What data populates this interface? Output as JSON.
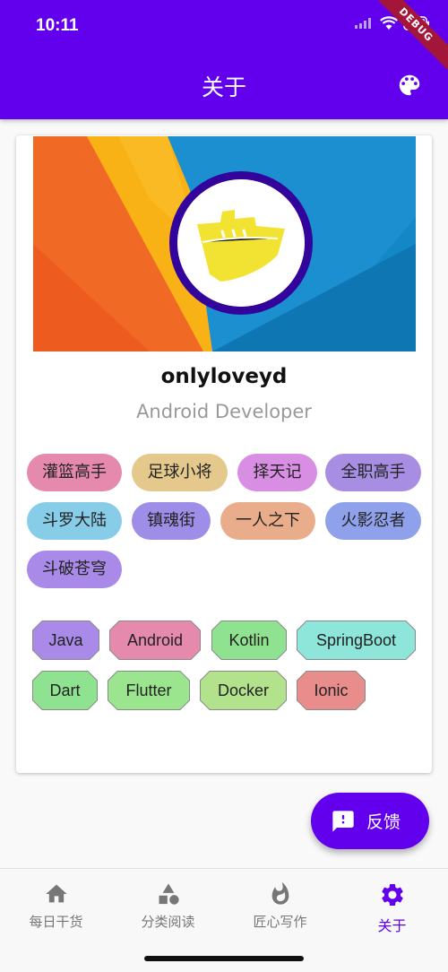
{
  "status_bar": {
    "time": "10:11",
    "debug_label": "DEBUG"
  },
  "appbar": {
    "title": "关于",
    "palette_icon": "palette-icon",
    "color": "#6200ee"
  },
  "profile": {
    "name": "onlyloveyd",
    "role": "Android Developer",
    "avatar_icon": "ship-icon"
  },
  "interests": [
    {
      "label": "灌篮高手",
      "color": "#e589ad"
    },
    {
      "label": "足球小将",
      "color": "#e5c98c"
    },
    {
      "label": "择天记",
      "color": "#d88ee3"
    },
    {
      "label": "全职高手",
      "color": "#a88ee3"
    },
    {
      "label": "斗罗大陆",
      "color": "#88cde8"
    },
    {
      "label": "镇魂街",
      "color": "#9e8ee7"
    },
    {
      "label": "一人之下",
      "color": "#e9ad8b"
    },
    {
      "label": "火影忍者",
      "color": "#8fa1eb"
    },
    {
      "label": "斗破苍穹",
      "color": "#a98ae8"
    }
  ],
  "skills": [
    {
      "label": "Java",
      "color": "#a98ae8"
    },
    {
      "label": "Android",
      "color": "#e589ad"
    },
    {
      "label": "Kotlin",
      "color": "#8fe28f"
    },
    {
      "label": "SpringBoot",
      "color": "#8ee6da"
    },
    {
      "label": "Dart",
      "color": "#8fe28f"
    },
    {
      "label": "Flutter",
      "color": "#9be58f"
    },
    {
      "label": "Docker",
      "color": "#b2e38c"
    },
    {
      "label": "Ionic",
      "color": "#e88c8c"
    }
  ],
  "fab": {
    "label": "反馈",
    "icon": "feedback-icon"
  },
  "bottom_nav": [
    {
      "label": "每日干货",
      "icon": "home-icon",
      "active": false
    },
    {
      "label": "分类阅读",
      "icon": "category-icon",
      "active": false
    },
    {
      "label": "匠心写作",
      "icon": "flame-icon",
      "active": false
    },
    {
      "label": "关于",
      "icon": "settings-icon",
      "active": true
    }
  ]
}
